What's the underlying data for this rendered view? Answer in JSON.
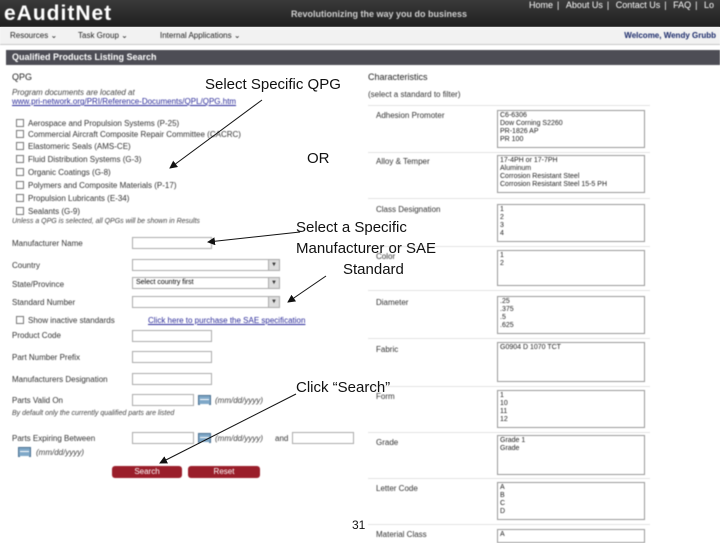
{
  "header": {
    "logo": "eAuditNet",
    "tagline": "Revolutionizing the way you do business",
    "links": [
      "Home",
      "About Us",
      "Contact Us",
      "FAQ",
      "Lo"
    ]
  },
  "menu": {
    "items": [
      "Resources",
      "Task Group",
      "Internal Applications"
    ],
    "welcome": "Welcome, Wendy Grubb"
  },
  "page": {
    "title": "Qualified Products Listing Search"
  },
  "qpg": {
    "heading": "QPG",
    "desc": "Program documents are located at",
    "link": "www.pri-network.org/PRI/Reference-Documents/QPL/QPG.htm",
    "items": [
      "Aerospace and Propulsion Systems (P-25)",
      "Commercial Aircraft Composite Repair Committee (CACRC)",
      "Elastomeric Seals (AMS-CE)",
      "Fluid Distribution Systems (G-3)",
      "Organic Coatings (G-8)",
      "Polymers and Composite Materials (P-17)",
      "Propulsion Lubricants (E-34)",
      "Sealants (G-9)"
    ],
    "unless_note": "Unless a QPG is selected, all QPGs will be shown in Results"
  },
  "form": {
    "manufacturer_name": "Manufacturer Name",
    "country": "Country",
    "state_province": "State/Province",
    "state_placeholder": "Select country first",
    "standard_number": "Standard Number",
    "show_inactive": "Show inactive standards",
    "purchase_link": "Click here to purchase the SAE specification",
    "product_code": "Product Code",
    "part_number_prefix": "Part Number Prefix",
    "manufacturers_designation": "Manufacturers Designation",
    "parts_valid_on": "Parts Valid On",
    "date_format": "(mm/dd/yyyy)",
    "default_note": "By default only the currently qualified parts are listed",
    "parts_expiring_between": "Parts Expiring Between",
    "and_label": "and",
    "search_button": "Search",
    "reset_button": "Reset"
  },
  "characteristics": {
    "heading": "Characteristics",
    "subheading": "(select a standard to filter)",
    "rows": [
      {
        "label": "Adhesion Promoter",
        "options": [
          "C6-6306",
          "Dow Corning S2260",
          "PR-1826 AP",
          "PR 100"
        ]
      },
      {
        "label": "Alloy & Temper",
        "options": [
          "17-4PH or 17-7PH",
          "Aluminum",
          "Corrosion Resistant Steel",
          "Corrosion Resistant Steel 15-5 PH"
        ]
      },
      {
        "label": "Class Designation",
        "options": [
          "1",
          "2",
          "3",
          "4"
        ]
      },
      {
        "label": "Color",
        "options": [
          "1",
          "2"
        ]
      },
      {
        "label": "Diameter",
        "options": [
          ".25",
          ".375",
          ".5",
          ".625"
        ]
      },
      {
        "label": "Fabric",
        "options": [
          "G0904 D 1070 TCT"
        ]
      },
      {
        "label": "Form",
        "options": [
          "1",
          "10",
          "11",
          "12"
        ]
      },
      {
        "label": "Grade",
        "options": [
          "Grade 1",
          "Grade"
        ]
      },
      {
        "label": "Letter Code",
        "options": [
          "A",
          "B",
          "C",
          "D"
        ]
      },
      {
        "label": "Material Class",
        "options": [
          "A"
        ]
      }
    ]
  },
  "annotations": {
    "select_qpg": "Select Specific QPG",
    "or": "OR",
    "select_manufacturer_line1": "Select a Specific",
    "select_manufacturer_line2": "Manufacturer or SAE",
    "select_manufacturer_line3": "Standard",
    "click_search": "Click “Search”",
    "page_number": "31"
  }
}
